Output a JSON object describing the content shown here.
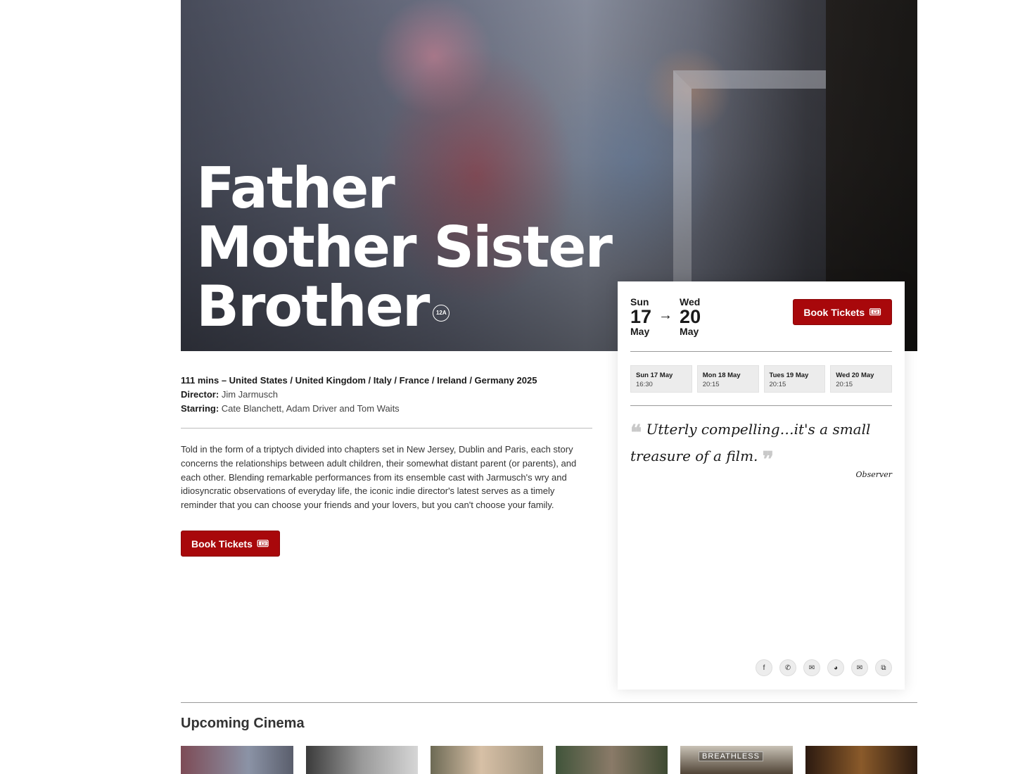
{
  "film": {
    "title_lines": [
      "Father",
      "Mother Sister",
      "Brother"
    ],
    "rating": "12A",
    "meta": "111 mins – United States / United Kingdom / Italy / France / Ireland / Germany 2025",
    "director_label": "Director:",
    "director": "Jim Jarmusch",
    "starring_label": "Starring:",
    "starring": "Cate Blanchett, Adam Driver and Tom Waits",
    "synopsis": "Told in the form of a triptych divided into chapters set in New Jersey, Dublin and Paris, each story concerns the relationships between adult children, their somewhat distant parent (or parents), and each other. Blending remarkable performances from its ensemble cast with Jarmusch's wry and idiosyncratic observations of everyday life, the iconic indie director's latest serves as a timely reminder that you can choose your friends and your lovers, but you can't choose your family.",
    "book_label": "Book Tickets"
  },
  "card": {
    "start": {
      "dow": "Sun",
      "num": "17",
      "mon": "May"
    },
    "end": {
      "dow": "Wed",
      "num": "20",
      "mon": "May"
    },
    "book_label": "Book Tickets",
    "showtimes": [
      {
        "date": "Sun 17 May",
        "time": "16:30"
      },
      {
        "date": "Mon 18 May",
        "time": "20:15"
      },
      {
        "date": "Tues 19 May",
        "time": "20:15"
      },
      {
        "date": "Wed 20 May",
        "time": "20:15"
      }
    ],
    "quote": "Utterly compelling…it's a small treasure of a film.",
    "quote_source": "Observer",
    "share_icons": [
      "facebook-icon",
      "whatsapp-icon",
      "messenger-icon",
      "reddit-icon",
      "email-icon",
      "copy-link-icon"
    ]
  },
  "upcoming": {
    "title": "Upcoming Cinema",
    "thumb_label": "BREATHLESS"
  },
  "colors": {
    "accent": "#a8080b",
    "chip_bg": "#ececec"
  }
}
